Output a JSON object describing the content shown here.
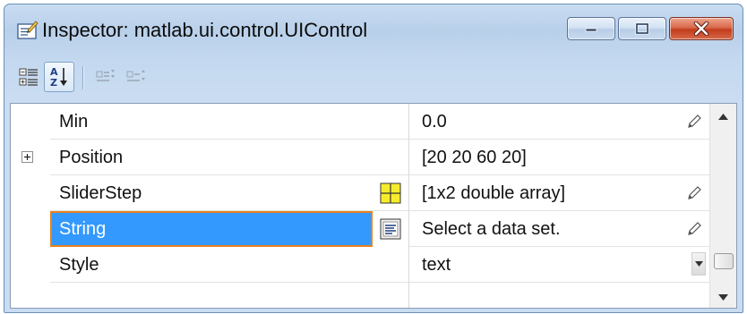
{
  "window": {
    "title": "Inspector:  matlab.ui.control.UIControl",
    "icon": "inspector-icon",
    "controls": [
      "minimize-icon",
      "maximize-icon",
      "close-icon"
    ]
  },
  "toolbar": {
    "buttons": [
      {
        "icon": "categorized-icon"
      },
      {
        "icon": "sort-alphabetical-icon",
        "pressed": true
      },
      {
        "icon": "expand-all-icon",
        "enabled": false
      },
      {
        "icon": "collapse-all-icon",
        "enabled": false
      }
    ]
  },
  "properties": [
    {
      "name": "Min",
      "value": "0.0",
      "editor": "pencil-icon"
    },
    {
      "name": "Position",
      "value": "[20 20 60 20]",
      "expandable": true
    },
    {
      "name": "SliderStep",
      "value": "[1x2  double array]",
      "button": "array-editor-icon",
      "editor": "pencil-icon"
    },
    {
      "name": "String",
      "value": "Select a data set.",
      "button": "text-editor-icon",
      "editor": "pencil-icon",
      "selected": true
    },
    {
      "name": "Style",
      "value": "text",
      "editor": "dropdown-icon"
    }
  ],
  "colors": {
    "selection": "#3399ff",
    "selection_border": "#e8821e",
    "titlebar": "#c9dcf1",
    "close_button": "#c23d1c"
  }
}
